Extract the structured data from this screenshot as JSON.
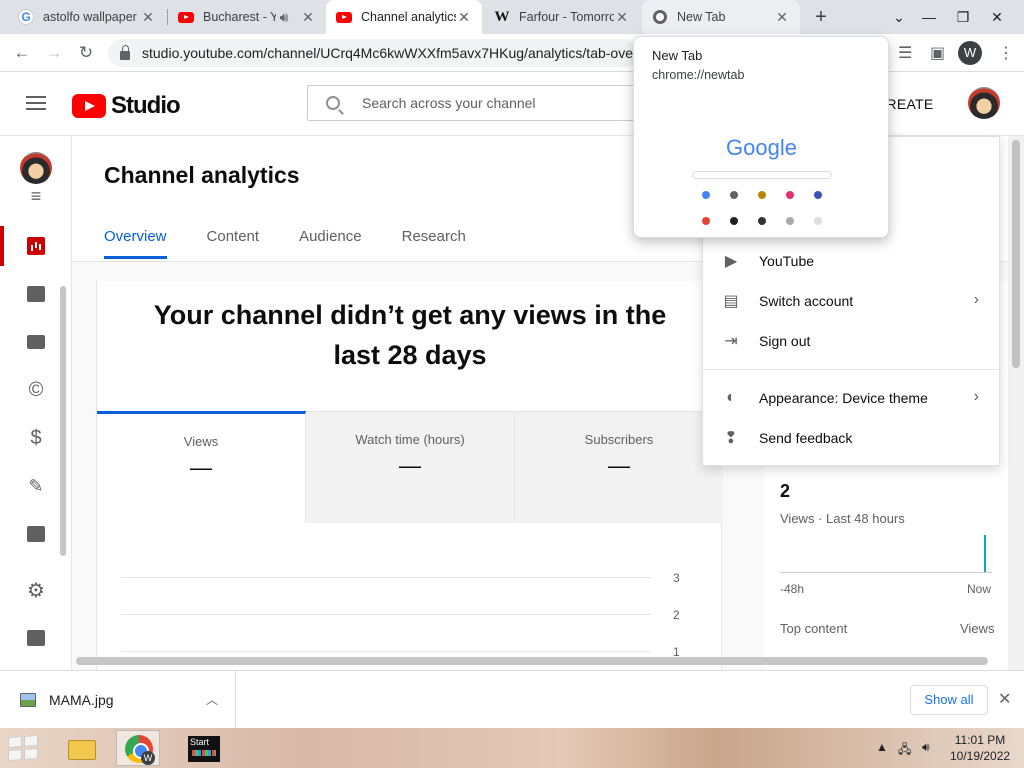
{
  "browser": {
    "tabs": [
      {
        "title": "astolfo wallpaper",
        "favicon": "google-icon"
      },
      {
        "title": "Bucharest - Y",
        "favicon": "youtube-icon",
        "audio": true
      },
      {
        "title": "Channel analytics",
        "favicon": "youtube-icon",
        "active": true
      },
      {
        "title": "Farfour - Tomorro",
        "favicon": "wikipedia-icon"
      },
      {
        "title": "New Tab",
        "favicon": "chrome-icon",
        "hovered": true
      }
    ],
    "url": "studio.youtube.com/channel/UCrq4Mc6kwWXXfm5avx7HKug/analytics/tab-ove",
    "profile_letter": "W"
  },
  "hover_card": {
    "title": "New Tab",
    "url": "chrome://newtab",
    "thumbnail_logo": "Google"
  },
  "studio": {
    "logo_text": "Studio",
    "search_placeholder": "Search across your channel",
    "create_label": "CREATE",
    "page_title": "Channel analytics",
    "tabs": [
      "Overview",
      "Content",
      "Audience",
      "Research"
    ],
    "headline_line1": "Your channel didn’t get any views in the",
    "headline_line2": "last 28 days",
    "metrics": [
      {
        "label": "Views",
        "value": "—"
      },
      {
        "label": "Watch time (hours)",
        "value": "—"
      },
      {
        "label": "Subscribers",
        "value": "—"
      }
    ],
    "chart_y_labels": [
      "3",
      "2",
      "1"
    ],
    "realtime": {
      "value": "2",
      "subtitle": "Views · Last 48 hours",
      "x_start": "-48h",
      "x_end": "Now",
      "top_content_label": "Top content",
      "views_label": "Views"
    }
  },
  "account_menu": {
    "items": [
      {
        "label": "YouTube",
        "icon": "youtube-outline-icon",
        "submenu": false
      },
      {
        "label": "Switch account",
        "icon": "switch-account-icon",
        "submenu": true
      },
      {
        "label": "Sign out",
        "icon": "sign-out-icon",
        "submenu": false
      },
      {
        "label": "Appearance: Device theme",
        "icon": "appearance-icon",
        "submenu": true
      },
      {
        "label": "Send feedback",
        "icon": "feedback-icon",
        "submenu": false
      }
    ]
  },
  "downloads": {
    "file_name": "MAMA.jpg",
    "show_all_label": "Show all"
  },
  "taskbar": {
    "start_app_label": "Start",
    "time": "11:01 PM",
    "date": "10/19/2022"
  },
  "colors": {
    "accent_blue": "#065fd4",
    "youtube_red": "#ff0000",
    "analytics_active": "#cc0000",
    "realtime_bar": "#12a4af"
  }
}
